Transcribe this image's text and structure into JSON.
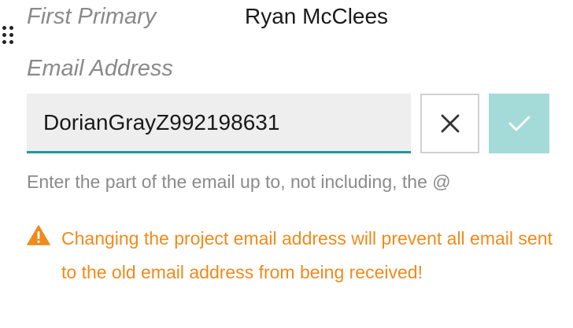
{
  "first_primary": {
    "label": "First Primary",
    "value": "Ryan McClees"
  },
  "email": {
    "label": "Email Address",
    "input_value": "DorianGrayZ992198631",
    "help_text": "Enter the part of the email up to, not including, the @",
    "accent_color": "#21979b"
  },
  "actions": {
    "cancel_icon": "close-icon",
    "confirm_icon": "check-icon",
    "confirm_color": "#a4dad7"
  },
  "warning": {
    "icon": "warning-triangle-icon",
    "text": "Changing the project email address will prevent all email sent to the old email address from being received!",
    "color": "#f08a1c"
  }
}
